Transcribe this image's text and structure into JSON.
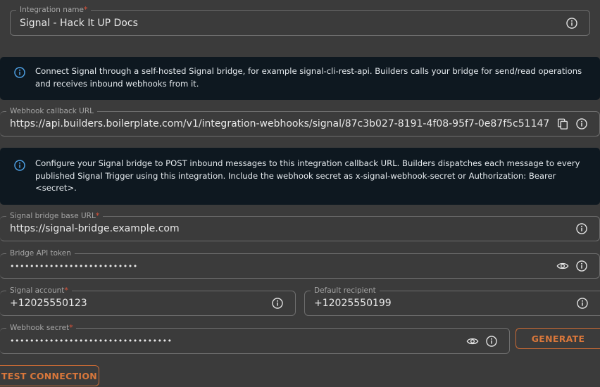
{
  "integration_name": {
    "label": "Integration name",
    "required": "*",
    "value": "Signal - Hack It UP Docs"
  },
  "info_connect": {
    "text": "Connect Signal through a self-hosted Signal bridge, for example signal-cli-rest-api. Builders calls your bridge for send/read operations and receives inbound webhooks from it."
  },
  "webhook_callback": {
    "label": "Webhook callback URL",
    "value": "https://api.builders.boilerplate.com/v1/integration-webhooks/signal/87c3b027-8191-4f08-95f7-0e87f5c51147"
  },
  "info_configure": {
    "text": "Configure your Signal bridge to POST inbound messages to this integration callback URL. Builders dispatches each message to every published Signal Trigger using this integration. Include the webhook secret as x-signal-webhook-secret or Authorization: Bearer <secret>."
  },
  "bridge_base_url": {
    "label": "Signal bridge base URL",
    "required": "*",
    "value": "https://signal-bridge.example.com"
  },
  "bridge_api_token": {
    "label": "Bridge API token",
    "value": "••••••••••••••••••••••••••"
  },
  "signal_account": {
    "label": "Signal account",
    "required": "*",
    "value": "+12025550123"
  },
  "default_recipient": {
    "label": "Default recipient",
    "value": "+12025550199"
  },
  "webhook_secret": {
    "label": "Webhook secret",
    "required": "*",
    "value": "•••••••••••••••••••••••••••••••••"
  },
  "buttons": {
    "generate": "GENERATE",
    "test_connection": "TEST CONNECTION"
  },
  "colors": {
    "accent": "#d9773b",
    "required": "#e0533a",
    "info_bg": "#0e1820",
    "info_icon": "#4fa3e8",
    "page_bg": "#3b3b3b"
  },
  "icons": [
    "info-icon",
    "copy-icon",
    "eye-icon"
  ]
}
